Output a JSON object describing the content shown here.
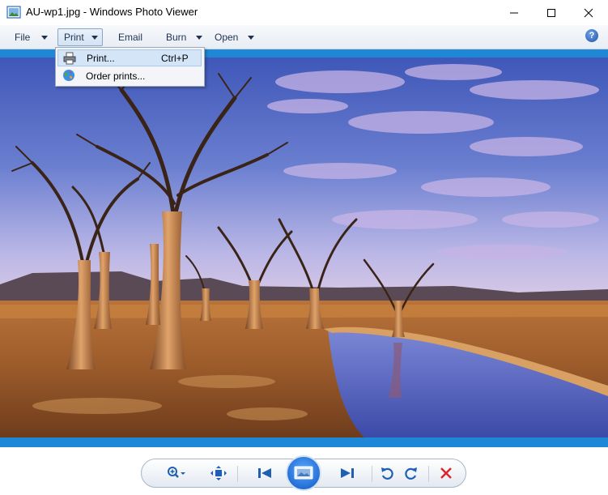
{
  "window": {
    "title": "AU-wp1.jpg - Windows Photo Viewer",
    "controls": [
      "minimize-icon",
      "maximize-icon",
      "close-icon"
    ]
  },
  "menu": {
    "items": [
      {
        "label": "File",
        "has_arrow": true
      },
      {
        "label": "Print",
        "has_arrow": true,
        "active": true
      },
      {
        "label": "Email",
        "has_arrow": false
      },
      {
        "label": "Burn",
        "has_arrow": true
      },
      {
        "label": "Open",
        "has_arrow": true
      }
    ],
    "help_icon": "help-icon"
  },
  "print_dropdown": {
    "items": [
      {
        "label": "Print...",
        "shortcut": "Ctrl+P",
        "icon": "printer-icon",
        "highlighted": true
      },
      {
        "label": "Order prints...",
        "shortcut": "",
        "icon": "globe-icon",
        "highlighted": false
      }
    ]
  },
  "toolbar": {
    "buttons": [
      "zoom-icon",
      "actual-size-icon",
      "previous-icon",
      "slideshow-icon",
      "next-icon",
      "rotate-counterclockwise-icon",
      "rotate-clockwise-icon",
      "delete-icon"
    ]
  },
  "colors": {
    "accent_blue": "#1e88d6",
    "delete_red": "#d9262e",
    "control_blue": "#1f5fb3"
  }
}
